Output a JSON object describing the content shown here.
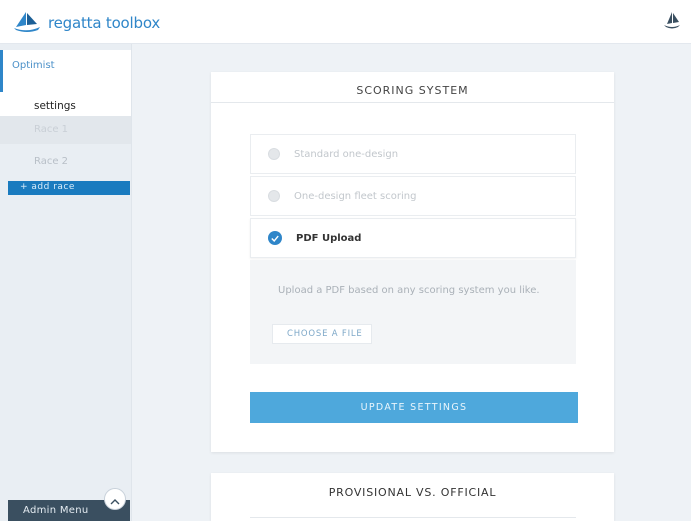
{
  "app": {
    "name": "regatta toolbox"
  },
  "sidebar": {
    "class_name": "Optimist",
    "items": [
      {
        "label": "settings"
      },
      {
        "label": "Race 1"
      },
      {
        "label": "Race 2"
      }
    ],
    "add_race_label": "+ add race",
    "admin_menu_label": "Admin Menu"
  },
  "scoring": {
    "title": "SCORING SYSTEM",
    "options": [
      {
        "label": "Standard one-design",
        "selected": false
      },
      {
        "label": "One-design fleet scoring",
        "selected": false
      },
      {
        "label": "PDF Upload",
        "selected": true
      }
    ],
    "upload_description": "Upload a PDF based on any scoring system you like.",
    "choose_file_label": "CHOOSE A FILE",
    "update_button_label": "UPDATE SETTINGS"
  },
  "provisional": {
    "title": "PROVISIONAL VS. OFFICIAL"
  },
  "colors": {
    "accent": "#2f86c9",
    "button": "#4ea8dc",
    "admin_bar": "#3a4f60"
  }
}
